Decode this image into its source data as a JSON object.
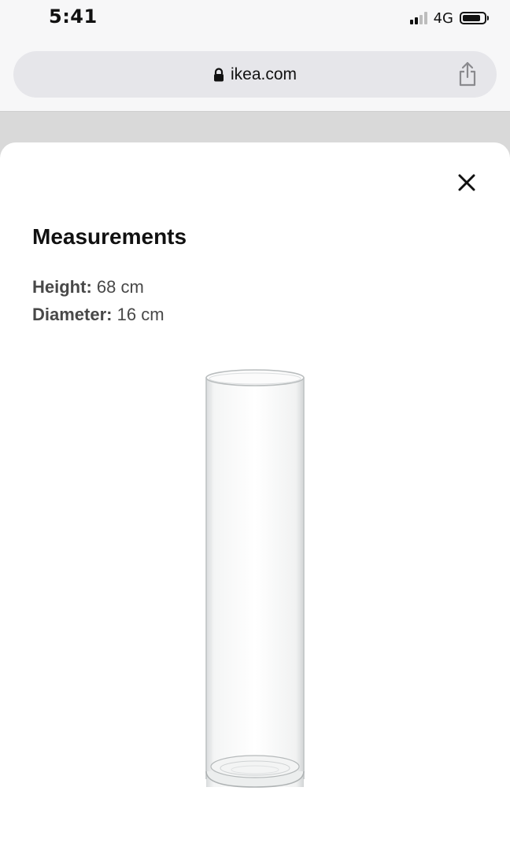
{
  "status_bar": {
    "time": "5:41",
    "network": "4G",
    "signal_bars_on": 2,
    "signal_bars_total": 4,
    "battery_level": 0.7
  },
  "browser": {
    "url": "ikea.com",
    "lock_icon": "lock-icon",
    "share_icon": "share-icon"
  },
  "sheet": {
    "close_icon": "close-icon",
    "title": "Measurements",
    "measurements": [
      {
        "label": "Height:",
        "value": "68 cm"
      },
      {
        "label": "Diameter:",
        "value": "16 cm"
      }
    ],
    "product_image": "glass-cylinder-vase"
  }
}
